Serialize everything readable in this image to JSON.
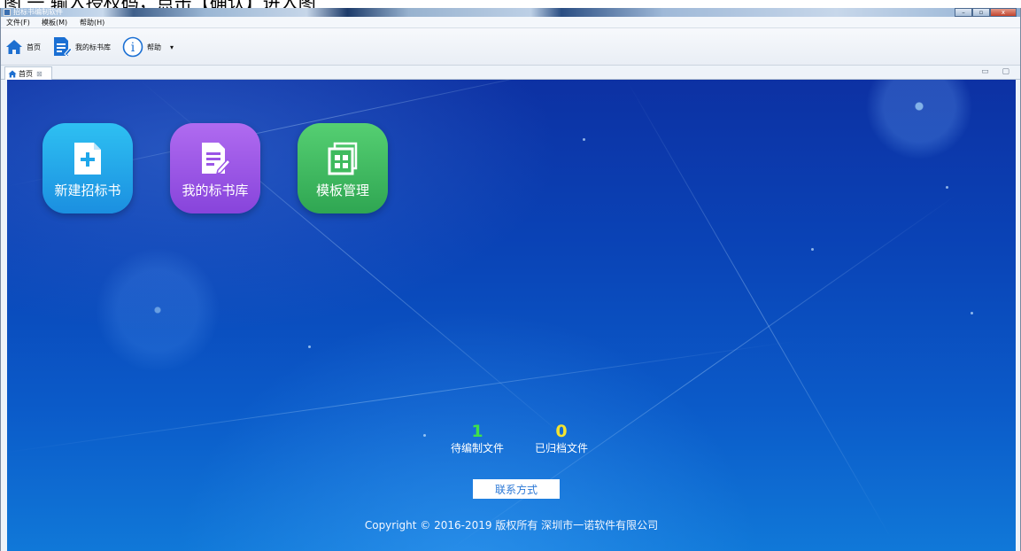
{
  "caption": "图 一 输入授权码，点击【确认】进入图",
  "window": {
    "title": "招标书编制软件",
    "controls": {
      "minimize": "–",
      "restore": "▫",
      "close": "x"
    }
  },
  "menubar": {
    "items": [
      {
        "label": "文件(F)"
      },
      {
        "label": "模板(M)"
      },
      {
        "label": "帮助(H)"
      }
    ]
  },
  "toolbar": {
    "home_label": "首页",
    "library_label": "我的标书库",
    "help_label": "帮助",
    "help_icon_glyph": "i",
    "dropdown_glyph": "▾"
  },
  "tabs": {
    "home_label": "首页",
    "close_glyph": "⊠",
    "view_controls": "▭ ▢"
  },
  "tiles": {
    "new": {
      "label": "新建招标书",
      "color": "#1fa7ea"
    },
    "library": {
      "label": "我的标书库",
      "color": "#9a55e6"
    },
    "templates": {
      "label": "模板管理",
      "color": "#3fbb5e"
    }
  },
  "stats": {
    "pending": {
      "value": "1",
      "label": "待编制文件",
      "color": "#3fe04a"
    },
    "archived": {
      "value": "0",
      "label": "已归档文件",
      "color": "#f3e331"
    }
  },
  "contact_label": "联系方式",
  "copyright": "Copyright © 2016-2019 版权所有 深圳市一诺软件有限公司"
}
